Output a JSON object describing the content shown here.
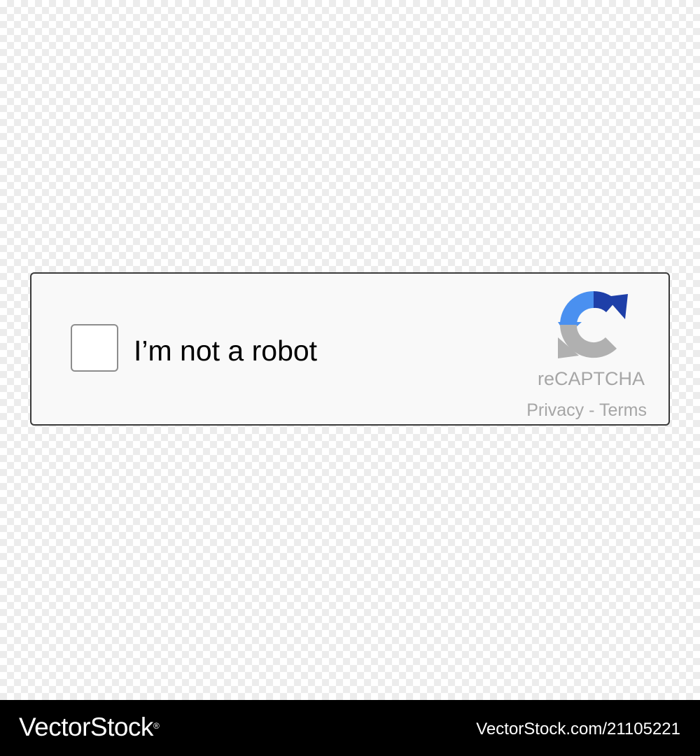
{
  "captcha": {
    "label": "I’m not a robot",
    "brand": "reCAPTCHA",
    "privacy_link": "Privacy",
    "separator": " - ",
    "terms_link": "Terms",
    "checked": false,
    "logo_icon": "recaptcha-arrows-icon",
    "colors": {
      "logo_blue_light": "#4a90f0",
      "logo_blue_dark": "#1e3fa8",
      "logo_gray": "#b0b0b0",
      "text_gray": "#a6a6a6",
      "border": "#3a3a3a",
      "background": "#f9f9f9"
    }
  },
  "watermark": {
    "logo_text": "VectorStock",
    "registered_mark": "®",
    "url_text": "VectorStock.com/21105221"
  }
}
